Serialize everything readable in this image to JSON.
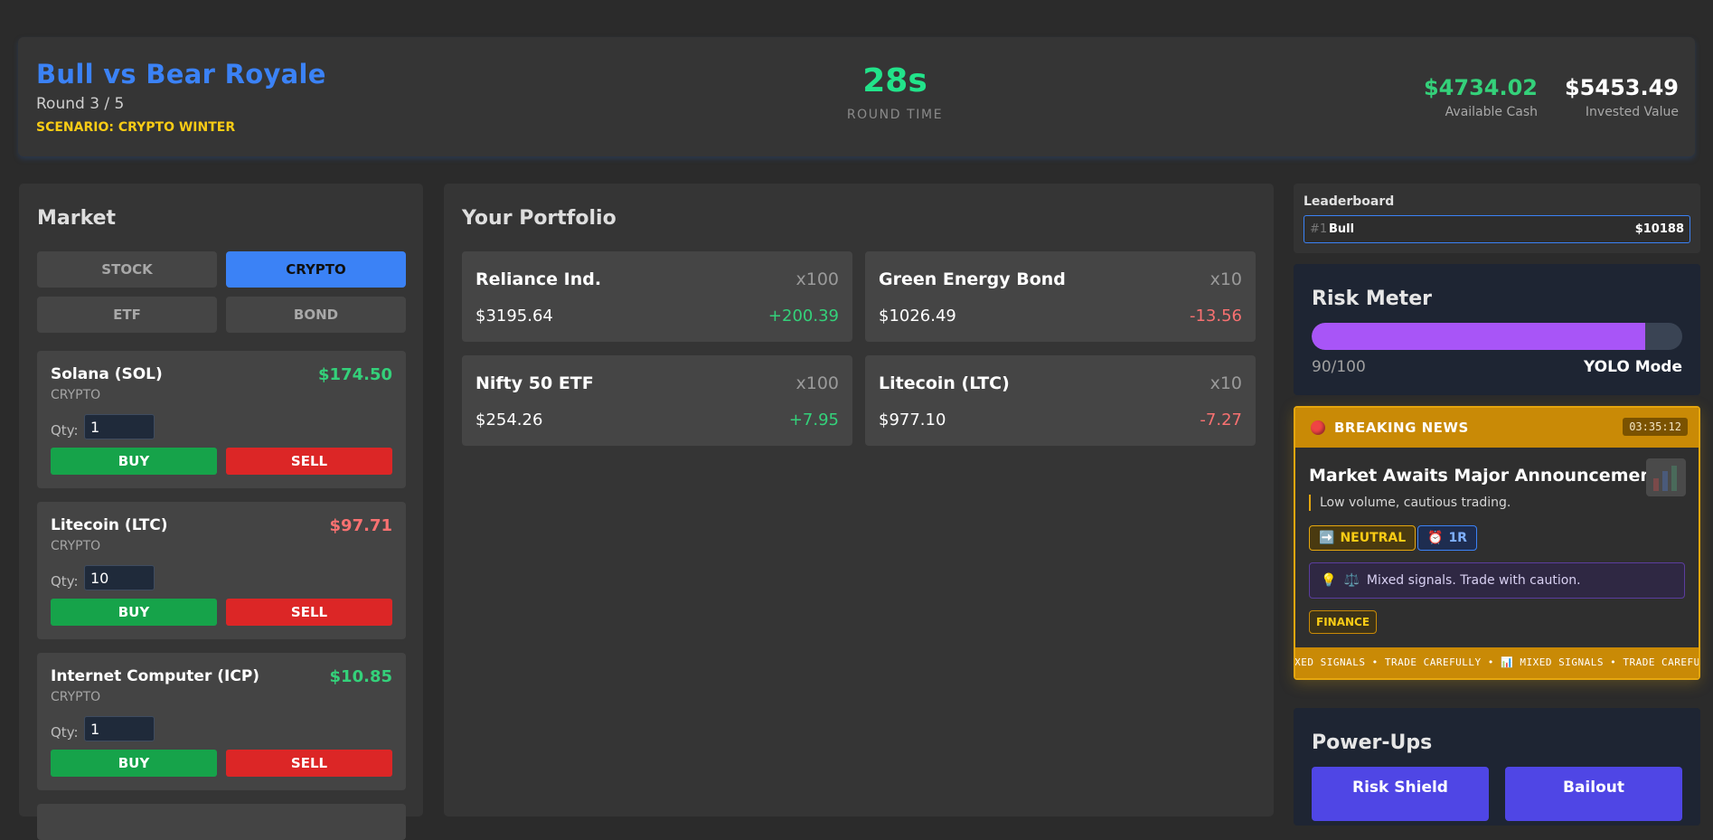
{
  "header": {
    "title": "Bull vs Bear Royale",
    "round": "Round 3 / 5",
    "scenario": "SCENARIO: CRYPTO WINTER",
    "timer": "28s",
    "timer_label": "ROUND TIME",
    "cash_value": "$4734.02",
    "cash_label": "Available Cash",
    "invested_value": "$5453.49",
    "invested_label": "Invested Value"
  },
  "market": {
    "title": "Market",
    "types": [
      {
        "label": "STOCK",
        "active": false
      },
      {
        "label": "CRYPTO",
        "active": true
      },
      {
        "label": "ETF",
        "active": false
      },
      {
        "label": "BOND",
        "active": false
      }
    ],
    "qty_label": "Qty:",
    "buy_label": "BUY",
    "sell_label": "SELL",
    "assets": [
      {
        "name": "Solana (SOL)",
        "type": "CRYPTO",
        "price": "$174.50",
        "price_color": "#34d17a",
        "qty": "1"
      },
      {
        "name": "Litecoin (LTC)",
        "type": "CRYPTO",
        "price": "$97.71",
        "price_color": "#f87171",
        "qty": "10"
      },
      {
        "name": "Internet Computer (ICP)",
        "type": "CRYPTO",
        "price": "$10.85",
        "price_color": "#34d17a",
        "qty": "1"
      }
    ]
  },
  "portfolio": {
    "title": "Your Portfolio",
    "holdings": [
      {
        "name": "Reliance Ind.",
        "qty": "x100",
        "price": "$3195.64",
        "change": "+200.39",
        "change_color": "#34d17a"
      },
      {
        "name": "Green Energy Bond",
        "qty": "x10",
        "price": "$1026.49",
        "change": "-13.56",
        "change_color": "#f87171"
      },
      {
        "name": "Nifty 50 ETF",
        "qty": "x100",
        "price": "$254.26",
        "change": "+7.95",
        "change_color": "#34d17a"
      },
      {
        "name": "Litecoin (LTC)",
        "qty": "x10",
        "price": "$977.10",
        "change": "-7.27",
        "change_color": "#f87171"
      }
    ]
  },
  "leaderboard": {
    "title": "Leaderboard",
    "rows": [
      {
        "rank": "#1",
        "name": "Bull",
        "score": "$10188"
      }
    ]
  },
  "risk": {
    "title": "Risk Meter",
    "level": 0.9,
    "score": "90/100",
    "mode": "YOLO Mode"
  },
  "news": {
    "label": "BREAKING NEWS",
    "time": "03:35:12",
    "headline": "Market Awaits Major Announcement",
    "body": "Low volume, cautious trading.",
    "sentiment_icon": "➡️",
    "sentiment": "NEUTRAL",
    "duration_icon": "⏰",
    "duration": "1R",
    "tip_icon": "💡",
    "tip_icon2": "⚖️",
    "tip": "Mixed signals. Trade with caution.",
    "category": "FINANCE",
    "ticker": "IXED SIGNALS • TRADE CAREFULLY • 📊 MIXED SIGNALS • TRADE CAREFUL"
  },
  "powerups": {
    "title": "Power-Ups",
    "items": [
      {
        "label": "Risk Shield"
      },
      {
        "label": "Bailout"
      }
    ]
  }
}
